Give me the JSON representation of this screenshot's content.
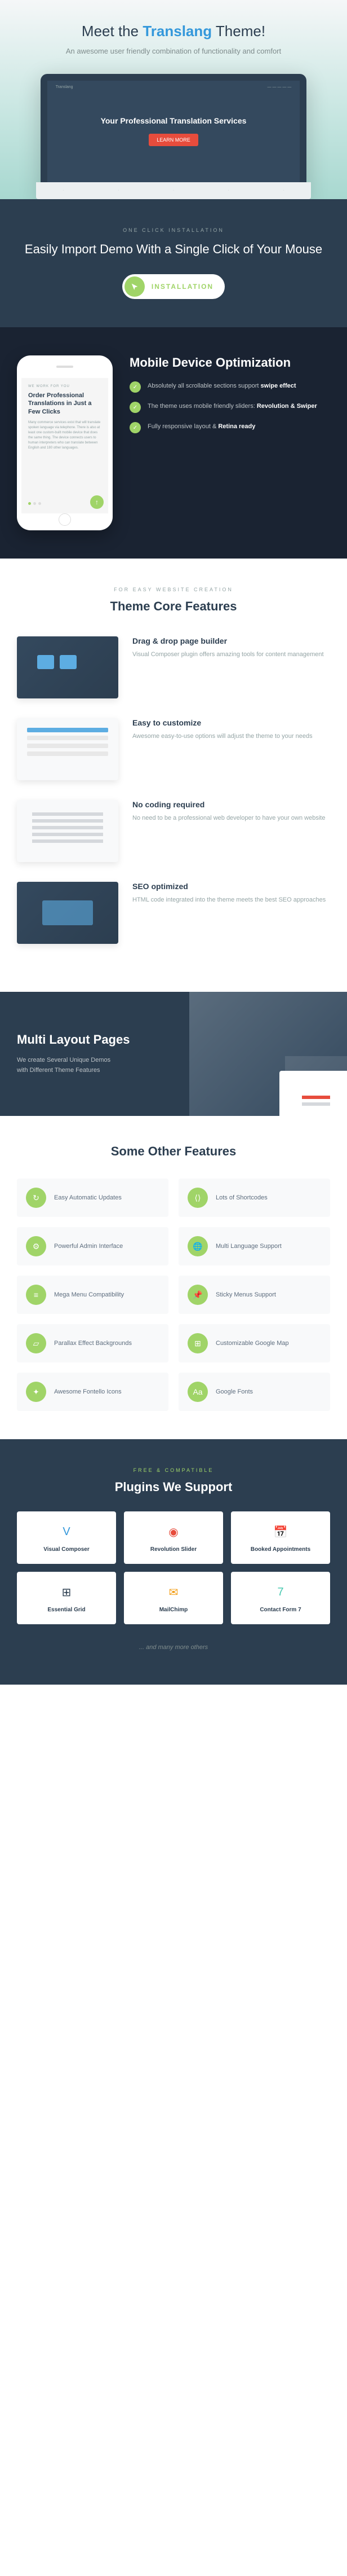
{
  "hero": {
    "title_prefix": "Meet the ",
    "title_brand": "Translang",
    "title_suffix": " Theme!",
    "subtitle": "An awesome user friendly combination of functionality and comfort",
    "laptop": {
      "nav_brand": "Translang",
      "heading": "Your Professional Translation Services",
      "button": "LEARN MORE"
    }
  },
  "install": {
    "eyebrow": "ONE CLICK INSTALLATION",
    "heading": "Easily Import Demo With a Single Click of Your Mouse",
    "button": "INSTALLATION"
  },
  "mobile": {
    "phone": {
      "eyebrow": "WE WORK FOR YOU",
      "title": "Order Professional Translations in Just a Few Clicks",
      "text": "Many commerce services exist that will translate spoken language via telephone. There is also at least one custom-built mobile device that does the same thing. The device connects users to human interpreters who can translate between English and 180 other languages."
    },
    "heading": "Mobile Device Optimization",
    "features": [
      {
        "prefix": "Absolutely all scrollable sections support ",
        "strong": "swipe effect",
        "suffix": ""
      },
      {
        "prefix": "The theme uses mobile friendly sliders: ",
        "strong": "Revolution & Swiper",
        "suffix": ""
      },
      {
        "prefix": "Fully responsive layout & ",
        "strong": "Retina ready",
        "suffix": ""
      }
    ]
  },
  "core": {
    "eyebrow": "FOR EASY WEBSITE CREATION",
    "heading": "Theme Core Features",
    "items": [
      {
        "title": "Drag & drop page builder",
        "text": "Visual Composer plugin offers amazing tools for content management"
      },
      {
        "title": "Easy to customize",
        "text": "Awesome easy-to-use options will adjust the theme to your needs"
      },
      {
        "title": "No coding required",
        "text": "No need to be a professional web developer to have your own website"
      },
      {
        "title": "SEO optimized",
        "text": "HTML code integrated into the theme meets the best SEO approaches"
      }
    ]
  },
  "multi": {
    "heading": "Multi Layout Pages",
    "text": "We create Several Unique Demos with Different Theme Features"
  },
  "other": {
    "heading": "Some Other Features",
    "items": [
      {
        "icon": "↻",
        "label": "Easy Automatic Updates"
      },
      {
        "icon": "⟨⟩",
        "label": "Lots of Shortcodes"
      },
      {
        "icon": "⚙",
        "label": "Powerful Admin Interface"
      },
      {
        "icon": "🌐",
        "label": "Multi Language Support"
      },
      {
        "icon": "≡",
        "label": "Mega Menu Compatibility"
      },
      {
        "icon": "📌",
        "label": "Sticky Menus Support"
      },
      {
        "icon": "▱",
        "label": "Parallax Effect Backgrounds"
      },
      {
        "icon": "⊞",
        "label": "Customizable Google Map"
      },
      {
        "icon": "✦",
        "label": "Awesome Fontello Icons"
      },
      {
        "icon": "Aa",
        "label": "Google Fonts"
      }
    ]
  },
  "plugins": {
    "eyebrow": "FREE & COMPATIBLE",
    "heading": "Plugins We Support",
    "items": [
      {
        "name": "Visual Composer",
        "color": "#3498db",
        "glyph": "V"
      },
      {
        "name": "Revolution Slider",
        "color": "#e74c3c",
        "glyph": "◉"
      },
      {
        "name": "Booked Appointments",
        "color": "#48c9b0",
        "glyph": "📅"
      },
      {
        "name": "Essential Grid",
        "color": "#2c3e50",
        "glyph": "⊞"
      },
      {
        "name": "MailChimp",
        "color": "#f39c12",
        "glyph": "✉"
      },
      {
        "name": "Contact Form 7",
        "color": "#48c9b0",
        "glyph": "7"
      }
    ],
    "more": "... and many more others"
  }
}
